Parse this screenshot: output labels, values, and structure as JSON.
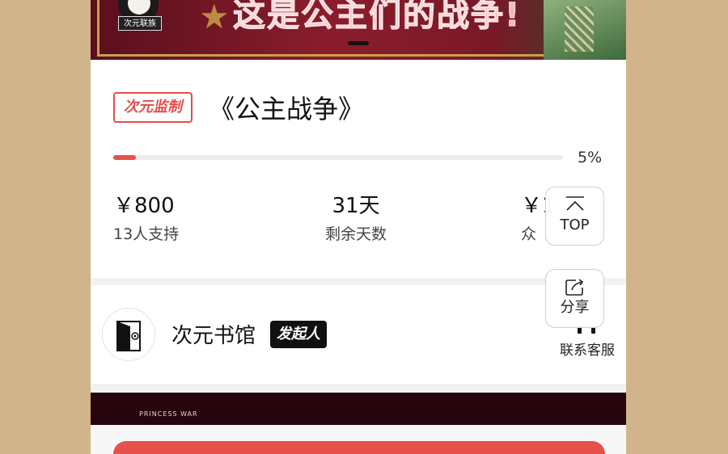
{
  "banner": {
    "logo_text": "次元联族",
    "title": "这是公主们的战争!"
  },
  "project": {
    "badge": "次元监制",
    "title": "《公主战争》",
    "progress": {
      "percent_label": "5%",
      "value": 0.05
    }
  },
  "stats": [
    {
      "value": "￥800",
      "label": "13人支持"
    },
    {
      "value": "31天",
      "label": "剩余天数"
    },
    {
      "value": "￥1",
      "label": "众"
    }
  ],
  "creator": {
    "name": "次元书馆",
    "role_badge": "发起人",
    "service_label": "联系客服"
  },
  "lower_banner": {
    "caption": "PRINCESS WAR"
  },
  "floating": {
    "top_label": "TOP",
    "share_label": "分享"
  },
  "colors": {
    "accent": "#e6514c",
    "page_background": "#d2b48c",
    "banner_background": "#8a1d2c"
  },
  "icons": [
    "chevron-up-icon",
    "share-icon",
    "door-logo-icon",
    "headset-icon",
    "star-icon"
  ]
}
